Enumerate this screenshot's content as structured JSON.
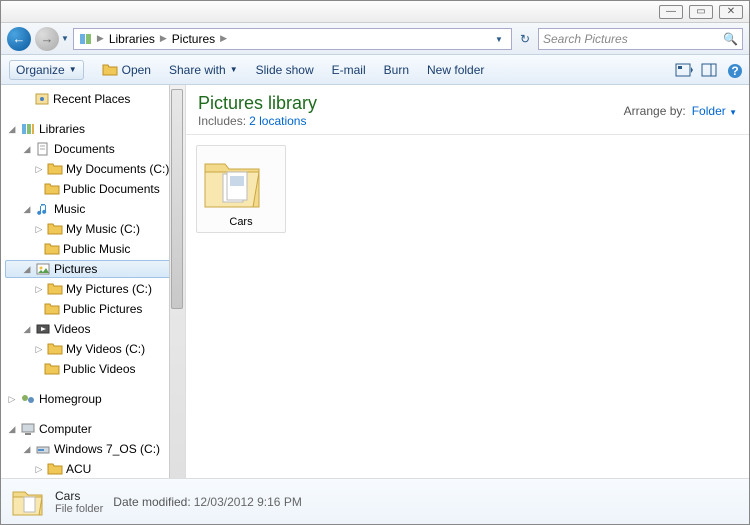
{
  "window_controls": {
    "min": "—",
    "max": "▭",
    "close": "✕"
  },
  "nav": {
    "breadcrumb": [
      "Libraries",
      "Pictures"
    ],
    "search_placeholder": "Search Pictures"
  },
  "toolbar": {
    "organize": "Organize",
    "open": "Open",
    "share": "Share with",
    "slideshow": "Slide show",
    "email": "E-mail",
    "burn": "Burn",
    "newfolder": "New folder"
  },
  "sidebar": {
    "recent": "Recent Places",
    "libraries": "Libraries",
    "documents": "Documents",
    "mydocs": "My Documents (C:)",
    "pubdocs": "Public Documents",
    "music": "Music",
    "mymusic": "My Music (C:)",
    "pubmusic": "Public Music",
    "pictures": "Pictures",
    "mypics": "My Pictures (C:)",
    "pubpics": "Public Pictures",
    "videos": "Videos",
    "myvids": "My Videos (C:)",
    "pubvids": "Public Videos",
    "homegroup": "Homegroup",
    "computer": "Computer",
    "osdisk": "Windows 7_OS (C:)",
    "acu": "ACU"
  },
  "library": {
    "title": "Pictures library",
    "includes_label": "Includes:",
    "includes_link": "2 locations",
    "arrange_label": "Arrange by:",
    "arrange_value": "Folder"
  },
  "items": [
    {
      "name": "Cars"
    }
  ],
  "details": {
    "name": "Cars",
    "type": "File folder",
    "modified_label": "Date modified:",
    "modified_value": "12/03/2012 9:16 PM"
  }
}
